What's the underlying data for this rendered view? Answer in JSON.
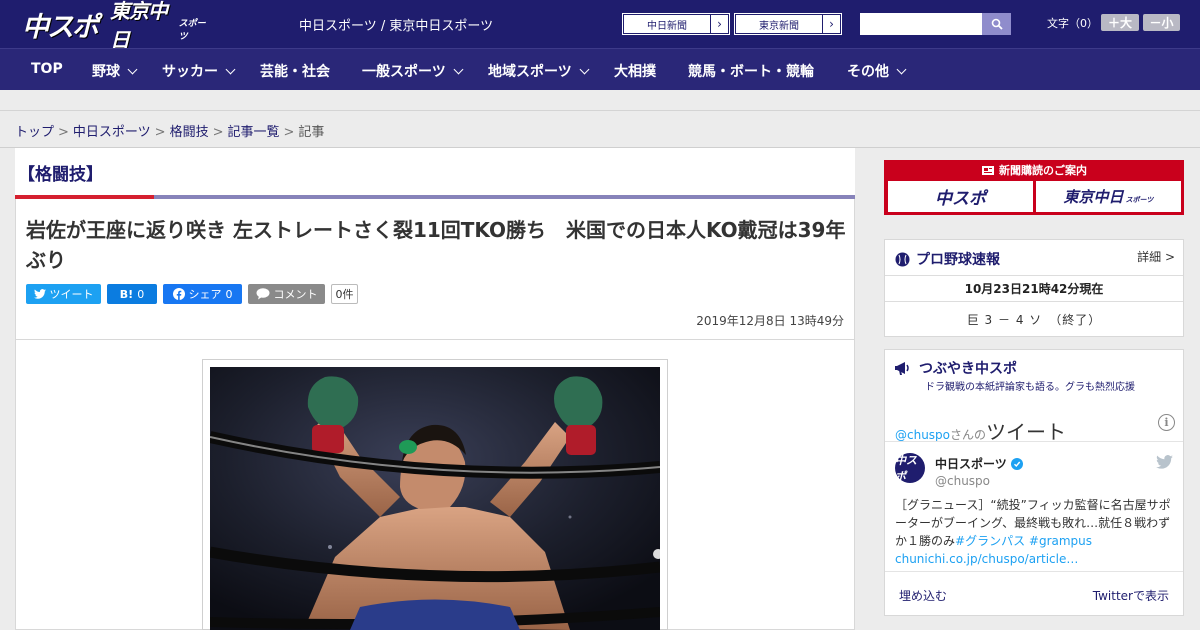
{
  "header": {
    "logo_main": "中スポ",
    "logo_tokyo": "東京中日",
    "logo_tokyo_small": "スポーツ",
    "sites": "中日スポーツ / 東京中日スポーツ",
    "ext_links": [
      {
        "label": "中日新聞",
        "arrow": "›"
      },
      {
        "label": "東京新聞",
        "arrow": "›"
      }
    ],
    "search_placeholder": "",
    "font_size_label": "文字（0）",
    "font_larger": "＋大",
    "font_smaller": "－小"
  },
  "nav": {
    "items": [
      {
        "label": "TOP",
        "has_menu": false
      },
      {
        "label": "野球",
        "has_menu": true
      },
      {
        "label": "サッカー",
        "has_menu": true
      },
      {
        "label": "芸能・社会",
        "has_menu": false
      },
      {
        "label": "一般スポーツ",
        "has_menu": true
      },
      {
        "label": "地域スポーツ",
        "has_menu": true
      },
      {
        "label": "大相撲",
        "has_menu": false
      },
      {
        "label": "競馬・ボート・競輪",
        "has_menu": false
      },
      {
        "label": "その他",
        "has_menu": true
      }
    ]
  },
  "breadcrumb": {
    "items": [
      "トップ",
      "中日スポーツ",
      "格闘技",
      "記事一覧"
    ],
    "current": "記事",
    "separator": ">"
  },
  "article": {
    "category": "【格闘技】",
    "headline": "岩佐が王座に返り咲き 左ストレートさく裂11回TKO勝ち　米国での日本人KO戴冠は39年ぶり",
    "share": {
      "tweet": "ツイート",
      "hatena_icon": "B!",
      "hatena_count": "0",
      "fb_share": "シェア",
      "fb_count": "0",
      "comment": "コメント",
      "comment_count": "0件"
    },
    "date": "2019年12月8日 13時49分"
  },
  "sidebar": {
    "ad": {
      "title": "新聞購読のご案内",
      "logo1": "中スポ",
      "logo2": "東京中日",
      "logo2_small": "スポーツ"
    },
    "baseball": {
      "title": "プロ野球速報",
      "detail": "詳細 >",
      "time": "10月23日21時42分現在",
      "score": "巨 3 － 4 ソ　（終了）"
    },
    "tweets": {
      "title": "つぶやき中スポ",
      "subtitle": "ドラ観戦の本紙評論家も語る。グラも熱烈応援",
      "handle": "@chuspo",
      "san_no": "さんの",
      "tweet_word": "ツイート",
      "info": "i",
      "avatar_text": "中スポ",
      "account_name": "中日スポーツ",
      "account_user": "@chuspo",
      "body_text": "［グラニュース］“続投”フィッカ監督に名古屋サポーターがブーイング、最終戦も敗れ…就任８戦わずか１勝のみ",
      "body_tag1": "#グランパス",
      "body_tag2": "#grampus",
      "body_link": "chunichi.co.jp/chuspo/article…",
      "embed": "埋め込む",
      "view_on_twitter": "Twitterで表示"
    }
  },
  "colors": {
    "brand_navy": "#1f1d6e",
    "accent_red": "#d5202f",
    "twitter_blue": "#1da1f2"
  }
}
